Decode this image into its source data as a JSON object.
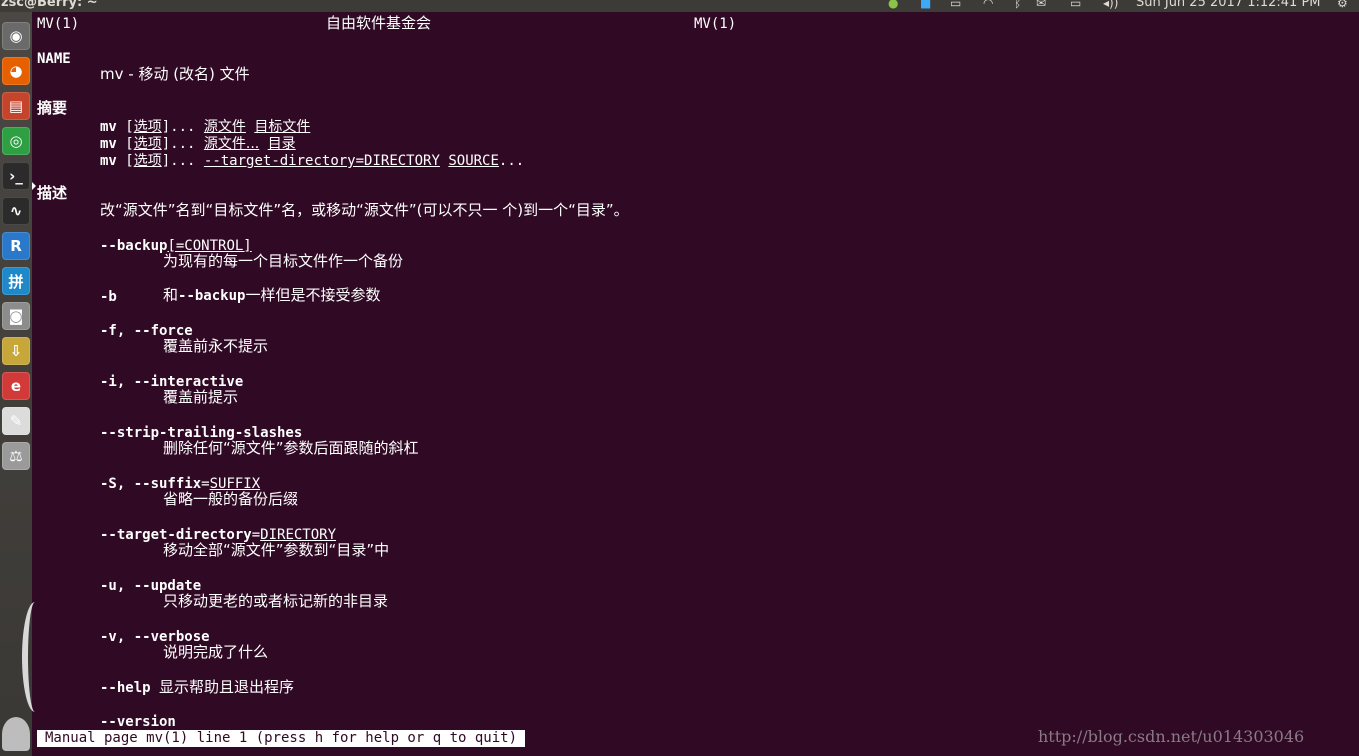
{
  "topbar": {
    "title": "zsc@Berry: ~",
    "clock": "Sun Jun 25 2017  1:12:41 PM",
    "indicators": [
      "chat-icon",
      "input-method-icon",
      "keyboard-icon",
      "wifi-icon",
      "bluetooth-icon",
      "mail-icon",
      "battery-icon",
      "volume-icon",
      "gear-icon"
    ]
  },
  "launcher": {
    "items": [
      {
        "name": "dash-home",
        "glyph": "◉",
        "color": "#6a6a6a"
      },
      {
        "name": "firefox",
        "glyph": "◕",
        "color": "#e66000"
      },
      {
        "name": "file-manager",
        "glyph": "▤",
        "color": "#c4452c"
      },
      {
        "name": "chrome",
        "glyph": "◎",
        "color": "#2ea043"
      },
      {
        "name": "terminal",
        "glyph": "›_",
        "color": "#2b2b2b"
      },
      {
        "name": "system-monitor",
        "glyph": "∿",
        "color": "#2b2b2b"
      },
      {
        "name": "r-app",
        "glyph": "R",
        "color": "#2a78c9"
      },
      {
        "name": "input-settings",
        "glyph": "拼",
        "color": "#1e88c9"
      },
      {
        "name": "screenshot",
        "glyph": "◙",
        "color": "#8c8c8c"
      },
      {
        "name": "archive",
        "glyph": "⇩",
        "color": "#c7a63a"
      },
      {
        "name": "pdf-reader",
        "glyph": "e",
        "color": "#d23a3a"
      },
      {
        "name": "text-editor",
        "glyph": "✎",
        "color": "#dcdcdc"
      },
      {
        "name": "settings",
        "glyph": "⚖",
        "color": "#9a9a9a"
      }
    ]
  },
  "man": {
    "header_left": "MV(1)",
    "header_center": "自由软件基金会",
    "header_right": "MV(1)",
    "name_heading": "NAME",
    "name_line": "mv - 移动 (改名) 文件",
    "synopsis_heading": "摘要",
    "synopsis": {
      "cmd": "mv",
      "open": "[",
      "option": "选项",
      "close_dots": "]...",
      "source": "源文件",
      "target_file": "目标文件",
      "source_dots": "源文件...",
      "directory": "目录",
      "target_dir_opt": "--target-directory=DIRECTORY",
      "source_upper": "SOURCE",
      "dots": "..."
    },
    "description_heading": "描述",
    "description": "改“源文件”名到“目标文件”名，或移动“源文件”(可以不只一 个)到一个“目录”。",
    "options": {
      "backup_flag": "--backup",
      "backup_arg": "[=CONTROL]",
      "backup_desc": "为现有的每一个目标文件作一个备份",
      "b_flag": "-b",
      "b_desc_pre": "和",
      "b_desc_flag": "--backup",
      "b_desc_post": "一样但是不接受参数",
      "force_flag": "-f, --force",
      "force_desc": "覆盖前永不提示",
      "interactive_flag": "-i, --interactive",
      "interactive_desc": "覆盖前提示",
      "strip_flag": "--strip-trailing-slashes",
      "strip_desc": "删除任何“源文件”参数后面跟随的斜杠",
      "suffix_flag": "-S, --suffix",
      "suffix_eq": "=",
      "suffix_arg": "SUFFIX",
      "suffix_desc": "省略一般的备份后缀",
      "tdir_flag": "--target-directory",
      "tdir_eq": "=",
      "tdir_arg": "DIRECTORY",
      "tdir_desc": "移动全部“源文件”参数到“目录”中",
      "update_flag": "-u, --update",
      "update_desc": "只移动更老的或者标记新的非目录",
      "verbose_flag": "-v, --verbose",
      "verbose_desc": "说明完成了什么",
      "help_flag": "--help",
      "help_desc": "显示帮助且退出程序",
      "version_flag": "--version"
    },
    "status": "Manual page mv(1) line 1 (press h for help or q to quit)"
  },
  "watermark": "http://blog.csdn.net/u014303046"
}
